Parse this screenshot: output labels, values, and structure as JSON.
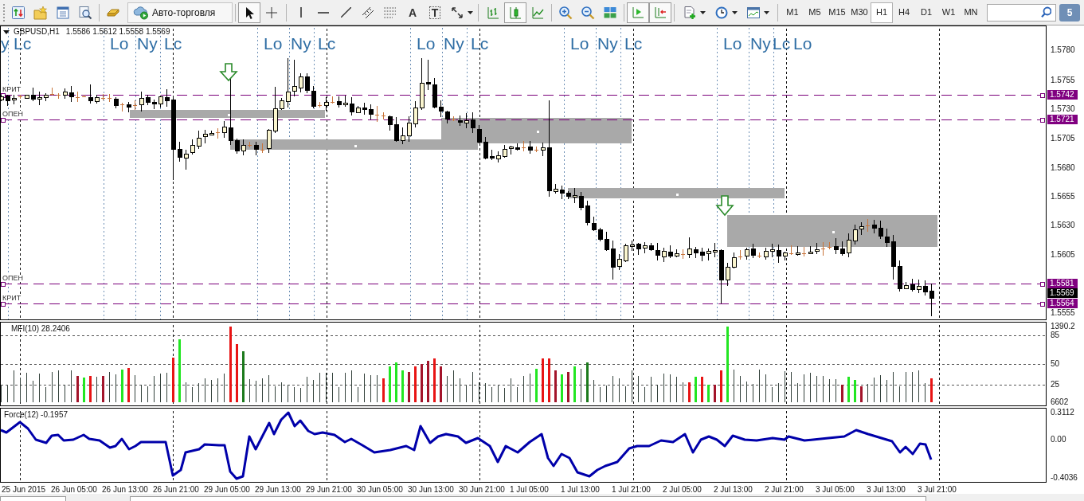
{
  "toolbar": {
    "auto_trading": {
      "label": "Авто-торговля"
    },
    "pointer_tools": [
      {
        "selected": true
      },
      {
        "selected": false
      }
    ],
    "text_tools": [
      {
        "glyph": "A"
      },
      {
        "glyph": "T"
      }
    ],
    "chart_types": [
      {
        "selected": false
      },
      {
        "selected": true
      },
      {
        "selected": false
      }
    ],
    "chart_options": [
      {
        "on": true
      },
      {
        "on": true
      }
    ],
    "timeframes": [
      {
        "label": "M1",
        "selected": false
      },
      {
        "label": "M5",
        "selected": false
      },
      {
        "label": "M15",
        "selected": false
      },
      {
        "label": "M30",
        "selected": false
      },
      {
        "label": "H1",
        "selected": true
      },
      {
        "label": "H4",
        "selected": false
      },
      {
        "label": "D1",
        "selected": false
      },
      {
        "label": "W1",
        "selected": false
      },
      {
        "label": "MN",
        "selected": false
      }
    ],
    "notifications": {
      "count": "5"
    }
  },
  "chart": {
    "header": {
      "symbol": "GBPUSD,H1",
      "prices": "1.5586 1.5612 1.5558 1.5569"
    },
    "session_labels": [
      "y",
      "Lc",
      "Lo",
      "Ny",
      "Lc",
      "Lo",
      "Ny",
      "Lc",
      "Lo",
      "Ny",
      "Lc",
      "Lo",
      "Ny",
      "Lc",
      "Lo",
      "Ny",
      "Lc",
      "Lo"
    ],
    "level_lines": [
      {
        "label": "КРИТ",
        "price": "1.5742"
      },
      {
        "label": "ОПЕН",
        "price": "1.5721"
      },
      {
        "label": "ОПЕН",
        "price": "1.5581"
      },
      {
        "label": "КРИТ",
        "price": "1.5564"
      }
    ],
    "current_price": "1.5569",
    "price_axis": [
      "1.5780",
      "1.5755",
      "1.5730",
      "1.5705",
      "1.5680",
      "1.5655",
      "1.5630",
      "1.5605",
      "1.5555"
    ]
  },
  "mfi": {
    "title": "MFI(10) 28.2406",
    "axis": [
      "1390.2",
      "85",
      "50",
      "25",
      "6602"
    ]
  },
  "force": {
    "title": "Force(12) -0.1957",
    "axis": [
      "0.3112",
      "0.00",
      "-0.4036"
    ]
  },
  "time_axis": [
    "25 Jun 2015",
    "26 Jun 05:00",
    "26 Jun 13:00",
    "26 Jun 21:00",
    "29 Jun 05:00",
    "29 Jun 13:00",
    "29 Jun 21:00",
    "30 Jun 05:00",
    "30 Jun 13:00",
    "30 Jun 21:00",
    "1 Jul 05:00",
    "1 Jul 13:00",
    "1 Jul 21:00",
    "2 Jul 05:00",
    "2 Jul 13:00",
    "2 Jul 21:00",
    "3 Jul 05:00",
    "3 Jul 13:00",
    "3 Jul 21:00"
  ]
}
